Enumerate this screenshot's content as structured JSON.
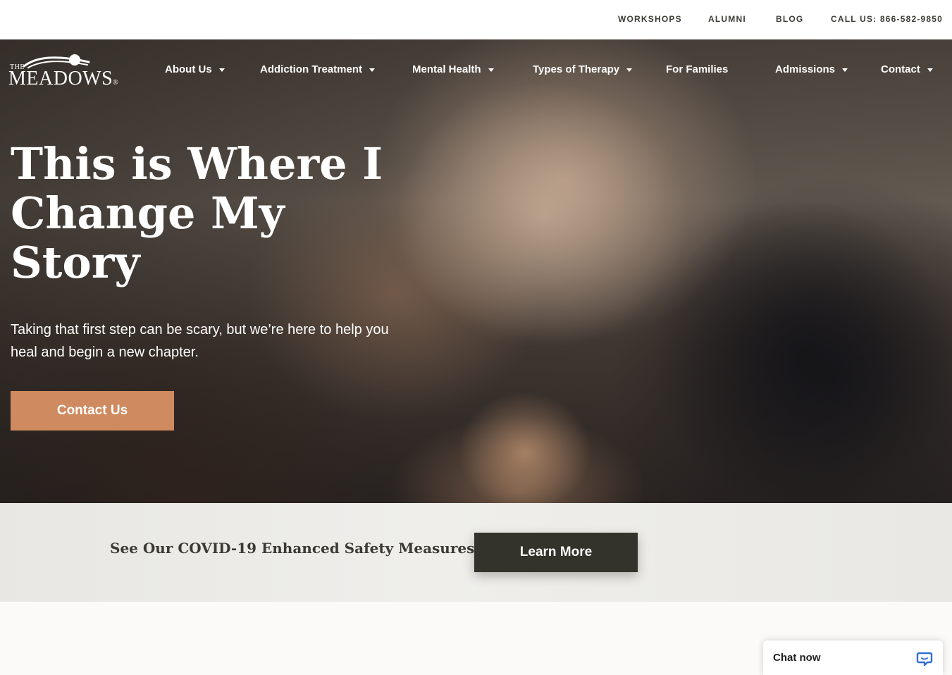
{
  "utility_nav": {
    "workshops": "WORKSHOPS",
    "alumni": "ALUMNI",
    "blog": "BLOG",
    "call": "CALL US: 866-582-9850"
  },
  "logo": {
    "small": "THE",
    "word": "MEADOWS",
    "mark": "®"
  },
  "main_nav": [
    {
      "label": "About Us",
      "has_dropdown": true
    },
    {
      "label": "Addiction Treatment",
      "has_dropdown": true
    },
    {
      "label": "Mental Health",
      "has_dropdown": true
    },
    {
      "label": "Types of Therapy",
      "has_dropdown": true
    },
    {
      "label": "For Families",
      "has_dropdown": false
    },
    {
      "label": "Admissions",
      "has_dropdown": true
    },
    {
      "label": "Contact",
      "has_dropdown": true
    }
  ],
  "hero": {
    "title": "This is Where I Change My Story",
    "subtitle": "Taking that first step can be scary, but we’re here to help you heal and begin a new chapter.",
    "cta_label": "Contact Us"
  },
  "covid": {
    "text": "See Our COVID-19 Enhanced Safety Measures",
    "button_label": "Learn More"
  },
  "chat": {
    "label": "Chat now"
  },
  "colors": {
    "accent": "#d08a5f",
    "dark_button": "#33332b",
    "chat_icon": "#2f6fd6"
  }
}
